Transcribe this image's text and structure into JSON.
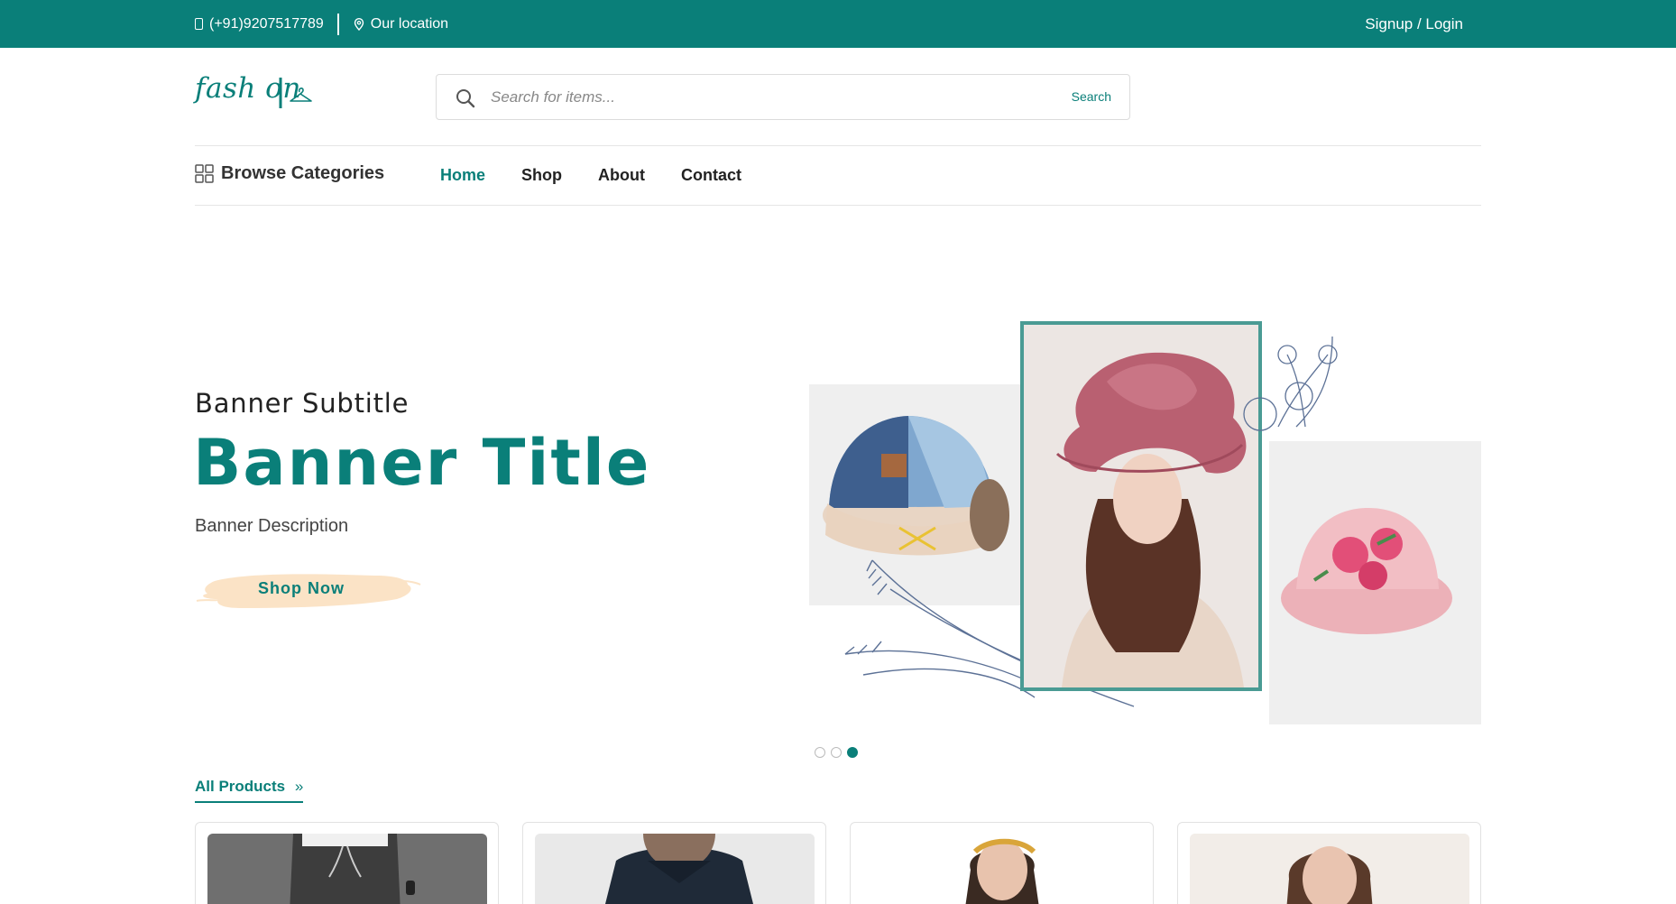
{
  "topbar": {
    "phone": "(+91)9207517789",
    "location": "Our location",
    "signup_login": "Signup / Login"
  },
  "header": {
    "logo_text": "fash on",
    "search_placeholder": "Search for items...",
    "search_button": "Search"
  },
  "nav": {
    "browse_categories": "Browse Categories",
    "links": [
      "Home",
      "Shop",
      "About",
      "Contact"
    ],
    "active": "Home"
  },
  "banner": {
    "subtitle": "Banner Subtitle",
    "title": "Banner Title",
    "description": "Banner Description",
    "cta": "Shop Now",
    "slides_total": 3,
    "active_slide": 3
  },
  "products": {
    "section_label": "All Products",
    "section_icon": "double-chevron-right-icon"
  },
  "colors": {
    "brand": "#0a7f79",
    "cta_brush": "#fbe3c6"
  }
}
